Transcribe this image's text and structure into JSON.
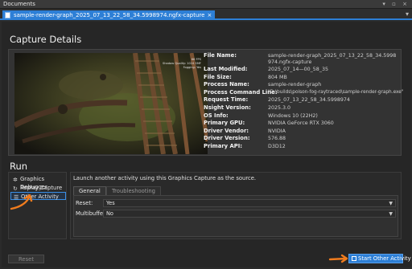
{
  "window": {
    "title": "Documents",
    "controls": "▾ ▫ ×"
  },
  "tab": {
    "label": "sample-render-graph_2025_07_13_22_58_34.5998974.ngfx-capture",
    "close": "×",
    "menu": "▾"
  },
  "capture_details": {
    "heading": "Capture Details",
    "screenshot_overlay": [
      "66 FPS",
      "Shadow Quality: 1024 SMF",
      "Fogging: Yes"
    ],
    "fields": [
      {
        "key": "File Name:",
        "value": "sample-render-graph_2025_07_13_22_58_34.5998974.ngfx-capture"
      },
      {
        "key": "Last Modified:",
        "value": "2025_07_14—00_58_35"
      },
      {
        "key": "File Size:",
        "value": "804 MB"
      },
      {
        "key": "Process Name:",
        "value": "sample-render-graph"
      },
      {
        "key": "Process Command Line:",
        "value": "\"D:\\builds\\poison-fog-raytraced\\sample-render-graph.exe\""
      },
      {
        "key": "Request Time:",
        "value": "2025_07_13_22_58_34.5998974"
      },
      {
        "key": "Nsight Version:",
        "value": "2025.3.0"
      },
      {
        "key": "OS Info:",
        "value": "Windows 10 (22H2)"
      },
      {
        "key": "Primary GPU:",
        "value": "NVIDIA GeForce RTX 3060"
      },
      {
        "key": "Driver Vendor:",
        "value": "NVIDIA"
      },
      {
        "key": "Driver Version:",
        "value": "576.88"
      },
      {
        "key": "Primary API:",
        "value": "D3D12"
      }
    ]
  },
  "run": {
    "heading": "Run",
    "activities": [
      {
        "label": "Graphics Debugger",
        "icon": "bug-icon"
      },
      {
        "label": "Replay Capture",
        "icon": "replay-icon"
      },
      {
        "label": "Other Activity",
        "icon": "list-icon"
      }
    ],
    "launch_text": "Launch another activity using this Graphics Capture as the source.",
    "tabs": {
      "general": "General",
      "troubleshooting": "Troubleshooting"
    },
    "reset_field": {
      "label": "Reset:",
      "value": "Yes"
    },
    "multibuffer_field": {
      "label": "Multibuffer:",
      "value": "No"
    },
    "reset_button": "Reset",
    "start_button": "Start Other Activity"
  },
  "colors": {
    "accent": "#2d7fd6",
    "annotation": "#f07c1e"
  }
}
